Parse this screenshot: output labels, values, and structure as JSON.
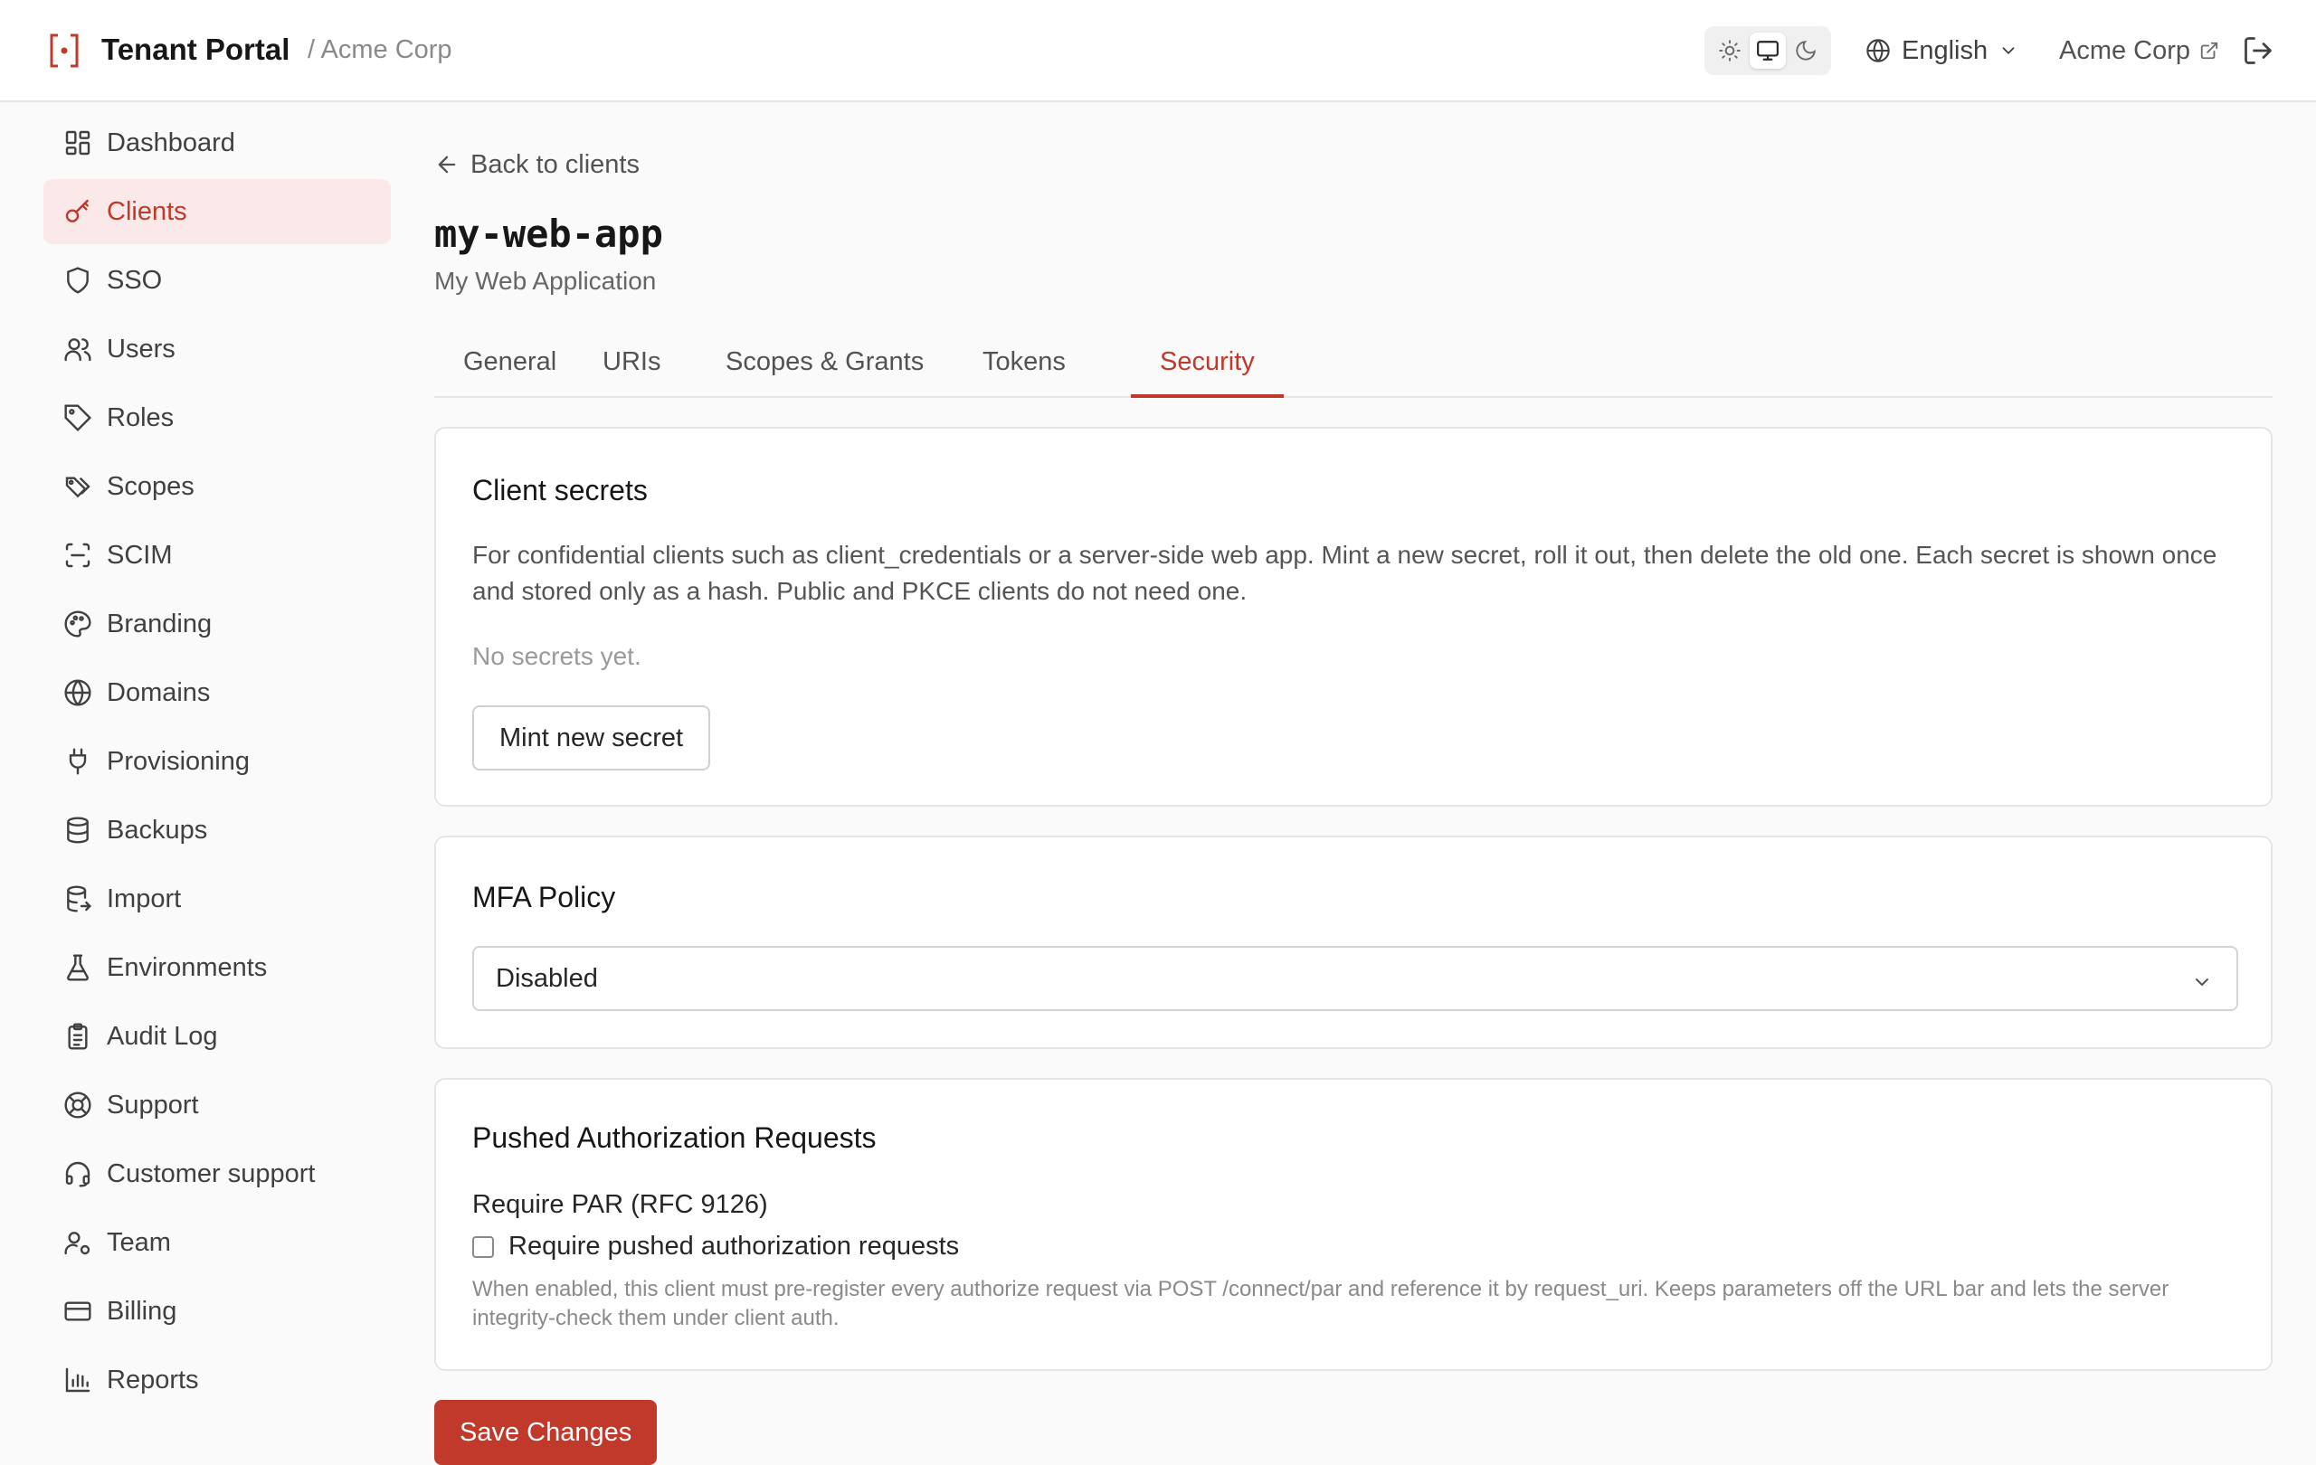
{
  "header": {
    "app_title": "Tenant Portal",
    "breadcrumb": "/ Acme Corp",
    "language": "English",
    "tenant_link": "Acme Corp",
    "brand_color": "#c0392b"
  },
  "sidebar": {
    "items": [
      {
        "label": "Dashboard",
        "icon": "dashboard-icon"
      },
      {
        "label": "Clients",
        "icon": "key-icon",
        "active": true
      },
      {
        "label": "SSO",
        "icon": "shield-icon"
      },
      {
        "label": "Users",
        "icon": "users-icon"
      },
      {
        "label": "Roles",
        "icon": "tag-icon"
      },
      {
        "label": "Scopes",
        "icon": "tags-icon"
      },
      {
        "label": "SCIM",
        "icon": "scan-icon"
      },
      {
        "label": "Branding",
        "icon": "palette-icon"
      },
      {
        "label": "Domains",
        "icon": "globe-icon"
      },
      {
        "label": "Provisioning",
        "icon": "plug-icon"
      },
      {
        "label": "Backups",
        "icon": "database-icon"
      },
      {
        "label": "Import",
        "icon": "database-import-icon"
      },
      {
        "label": "Environments",
        "icon": "flask-icon"
      },
      {
        "label": "Audit Log",
        "icon": "clipboard-icon"
      },
      {
        "label": "Support",
        "icon": "lifebuoy-icon"
      },
      {
        "label": "Customer support",
        "icon": "headset-icon"
      },
      {
        "label": "Team",
        "icon": "user-cog-icon"
      },
      {
        "label": "Billing",
        "icon": "credit-card-icon"
      },
      {
        "label": "Reports",
        "icon": "bar-chart-icon"
      }
    ]
  },
  "main": {
    "back_label": "Back to clients",
    "client_id": "my-web-app",
    "client_name": "My Web Application",
    "tabs": [
      {
        "label": "General"
      },
      {
        "label": "URIs"
      },
      {
        "label": "Scopes & Grants"
      },
      {
        "label": "Tokens"
      },
      {
        "label": "Security",
        "active": true
      }
    ],
    "secrets": {
      "title": "Client secrets",
      "description": "For confidential clients such as client_credentials or a server-side web app. Mint a new secret, roll it out, then delete the old one. Each secret is shown once and stored only as a hash. Public and PKCE clients do not need one.",
      "empty": "No secrets yet.",
      "mint_label": "Mint new secret"
    },
    "mfa": {
      "title": "MFA Policy",
      "selected": "Disabled"
    },
    "par": {
      "title": "Pushed Authorization Requests",
      "field_label": "Require PAR (RFC 9126)",
      "checkbox_label": "Require pushed authorization requests",
      "checked": false,
      "help": "When enabled, this client must pre-register every authorize request via POST /connect/par and reference it by request_uri. Keeps parameters off the URL bar and lets the server integrity-check them under client auth."
    },
    "save_label": "Save Changes"
  }
}
